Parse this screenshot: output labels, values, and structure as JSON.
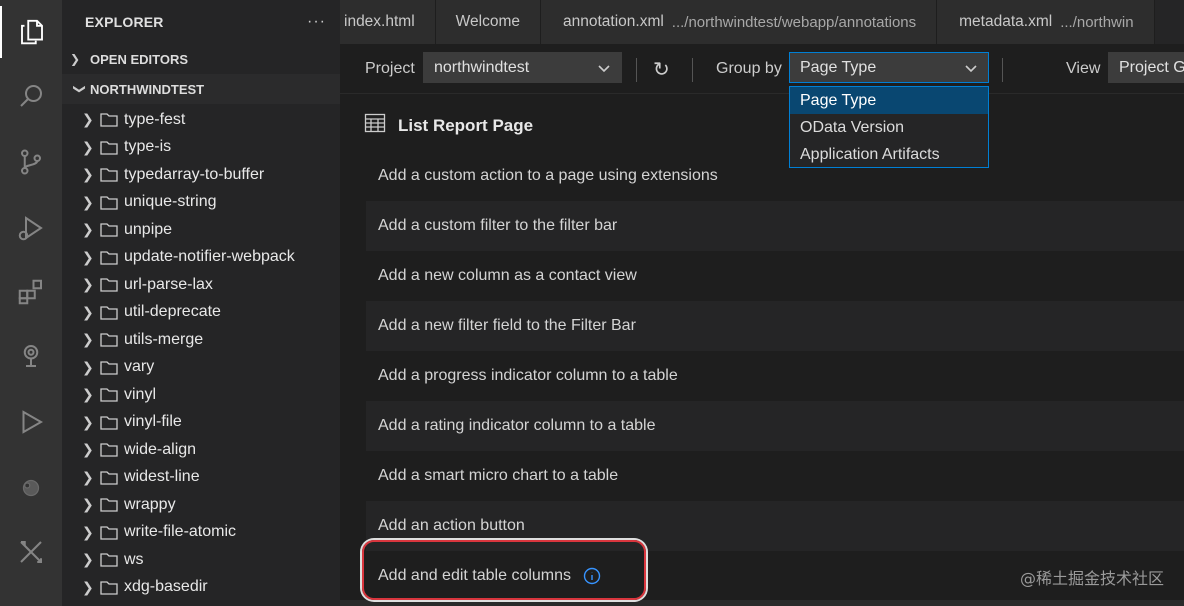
{
  "activity_bar": {
    "items": [
      {
        "icon": "files-icon",
        "active": true
      },
      {
        "icon": "search-icon"
      },
      {
        "icon": "source-control-icon"
      },
      {
        "icon": "run-debug-icon"
      },
      {
        "icon": "extensions-icon"
      },
      {
        "icon": "remote-explorer-icon"
      },
      {
        "icon": "run-icon"
      },
      {
        "icon": "cloud-icon"
      },
      {
        "icon": "tools-icon"
      }
    ]
  },
  "sidebar": {
    "title": "EXPLORER",
    "more": "···",
    "sections": {
      "open_editors": "OPEN EDITORS",
      "project": "NORTHWINDTEST"
    },
    "tree": [
      "type-fest",
      "type-is",
      "typedarray-to-buffer",
      "unique-string",
      "unpipe",
      "update-notifier-webpack",
      "url-parse-lax",
      "util-deprecate",
      "utils-merge",
      "vary",
      "vinyl",
      "vinyl-file",
      "wide-align",
      "widest-line",
      "wrappy",
      "write-file-atomic",
      "ws",
      "xdg-basedir"
    ]
  },
  "tabs": [
    {
      "label": "index.html",
      "path": ""
    },
    {
      "label": "Welcome",
      "path": ""
    },
    {
      "label": "annotation.xml",
      "path": ".../northwindtest/webapp/annotations"
    },
    {
      "label": "metadata.xml",
      "path": ".../northwin"
    }
  ],
  "toolbar": {
    "project_label": "Project",
    "project_value": "northwindtest",
    "refresh_icon": "↻",
    "group_by_label": "Group by",
    "group_by_value": "Page Type",
    "view_label": "View",
    "view_value": "Project G"
  },
  "dropdown": {
    "options": [
      "Page Type",
      "OData Version",
      "Application Artifacts"
    ],
    "selected": "Page Type"
  },
  "content": {
    "section_title": "List Report Page",
    "items": [
      "Add a custom action to a page using extensions",
      "Add a custom filter to the filter bar",
      "Add a new column as a contact view",
      "Add a new filter field to the Filter Bar",
      "Add a progress indicator column to a table",
      "Add a rating indicator column to a table",
      "Add a smart micro chart to a table",
      "Add an action button",
      "Add and edit table columns"
    ]
  },
  "watermark": "@稀土掘金技术社区",
  "colors": {
    "accent": "#007fd4",
    "selection": "#094771",
    "highlight_ring": "#d9363e"
  }
}
